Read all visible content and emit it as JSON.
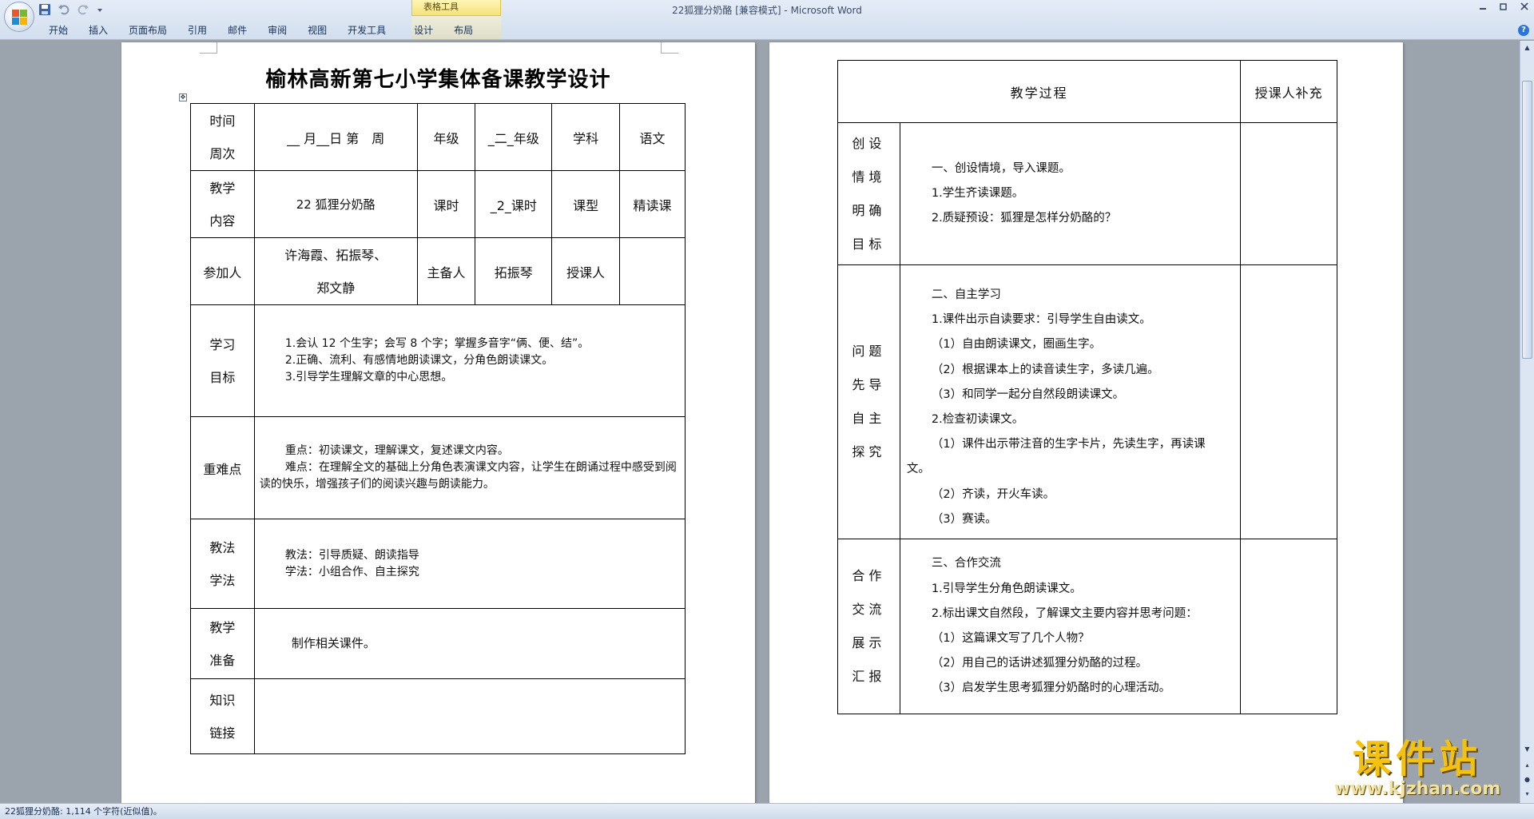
{
  "window": {
    "title": "22狐狸分奶酪 [兼容模式] - Microsoft Word",
    "context_tab_group": "表格工具",
    "ribbon_tabs": [
      "开始",
      "插入",
      "页面布局",
      "引用",
      "邮件",
      "审阅",
      "视图",
      "开发工具",
      "设计",
      "布局"
    ],
    "help": "?"
  },
  "status": {
    "text": "22狐狸分奶酪: 1,114 个字符(近似值)。"
  },
  "left_page": {
    "heading": "榆林高新第七小学集体备课教学设计",
    "rows": {
      "time_label": [
        "时间",
        "周次"
      ],
      "time_value": "__ 月__日 第　周",
      "grade_label": "年级",
      "grade_value": "_二_年级",
      "subject_label": "学科",
      "subject_value": "语文",
      "content_label": [
        "教学",
        "内容"
      ],
      "content_value": "22 狐狸分奶酪",
      "hours_label": "课时",
      "hours_value": "_2_课时",
      "type_label": "课型",
      "type_value": "精读课",
      "participants_label": "参加人",
      "participants_value": [
        "许海霞、拓振琴、",
        "郑文静"
      ],
      "lead_label": "主备人",
      "lead_value": "拓振琴",
      "teacher_label": "授课人",
      "teacher_value": "",
      "goals_label": [
        "学习",
        "目标"
      ],
      "goals": [
        "1.会认 12 个生字；会写 8 个字；掌握多音字“俩、便、结”。",
        "2.正确、流利、有感情地朗读课文，分角色朗读课文。",
        "3.引导学生理解文章的中心思想。"
      ],
      "keypoints_label": "重难点",
      "keypoints": [
        "重点：初读课文，理解课文，复述课文内容。",
        "难点：在理解全文的基础上分角色表演课文内容，让学生在朗诵过程中感受到阅读的快乐，增强孩子们的阅读兴趣与朗读能力。"
      ],
      "methods_label": [
        "教法",
        "学法"
      ],
      "methods": [
        "教法：引导质疑、朗读指导",
        "学法：小组合作、自主探究"
      ],
      "prep_label": [
        "教学",
        "准备"
      ],
      "prep": "制作相关课件。",
      "knowledge_label": [
        "知识",
        "链接"
      ],
      "knowledge": ""
    }
  },
  "right_page": {
    "head_process": "教学过程",
    "head_supplement": "授课人补充",
    "sections": [
      {
        "label": [
          "创设",
          "情境",
          "明确",
          "目标"
        ],
        "lines": [
          "一、创设情境，导入课题。",
          "1.学生齐读课题。",
          "2.质疑预设：狐狸是怎样分奶酪的？"
        ]
      },
      {
        "label": [
          "问题",
          "先导",
          "自主",
          "探究"
        ],
        "lines": [
          "",
          "二、自主学习",
          "1.课件出示自读要求：引导学生自由读文。",
          "（1）自由朗读课文，圈画生字。",
          "（2）根据课本上的读音读生字，多读几遍。",
          "（3）和同学一起分自然段朗读课文。",
          "2.检查初读课文。",
          "（1）课件出示带注音的生字卡片，先读生字，再读课",
          "文。",
          "（2）齐读，开火车读。",
          "（3）赛读。"
        ]
      },
      {
        "label": [
          "合作",
          "交流",
          "展示",
          "汇报"
        ],
        "lines": [
          "三、合作交流",
          "1.引导学生分角色朗读课文。",
          "2.标出课文自然段，了解课文主要内容并思考问题：",
          "（1）这篇课文写了几个人物？",
          "（2）用自己的话讲述狐狸分奶酪的过程。",
          "（3）启发学生思考狐狸分奶酪时的心理活动。"
        ]
      }
    ]
  },
  "watermark": {
    "cn": "课件站",
    "en": "www.kjzhan.com"
  },
  "colors": {
    "ribbon": "#d3dfee",
    "workspace": "#9ba3ad",
    "watermark": "#f2c20f"
  }
}
